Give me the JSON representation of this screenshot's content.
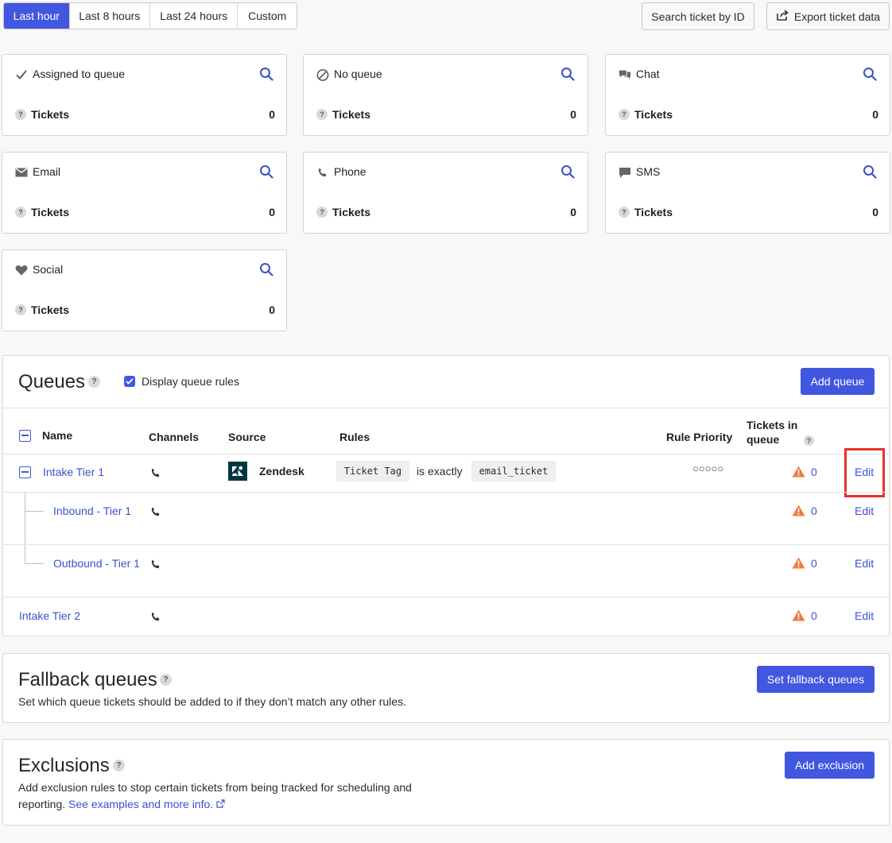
{
  "time_range": {
    "tabs": [
      "Last hour",
      "Last 8 hours",
      "Last 24 hours",
      "Custom"
    ],
    "active": "Last hour"
  },
  "toolbar": {
    "search_ticket_label": "Search ticket by ID",
    "export_label": "Export ticket data"
  },
  "cards": [
    {
      "title": "Assigned to queue",
      "icon": "check-icon",
      "label": "Tickets",
      "value": "0"
    },
    {
      "title": "No queue",
      "icon": "no-entry-icon",
      "label": "Tickets",
      "value": "0"
    },
    {
      "title": "Chat",
      "icon": "chat-icon",
      "label": "Tickets",
      "value": "0"
    },
    {
      "title": "Email",
      "icon": "envelope-icon",
      "label": "Tickets",
      "value": "0"
    },
    {
      "title": "Phone",
      "icon": "phone-icon",
      "label": "Tickets",
      "value": "0"
    },
    {
      "title": "SMS",
      "icon": "sms-icon",
      "label": "Tickets",
      "value": "0"
    },
    {
      "title": "Social",
      "icon": "heart-icon",
      "label": "Tickets",
      "value": "0"
    }
  ],
  "help_glyph": "?",
  "queues": {
    "title": "Queues",
    "display_rules_label": "Display queue rules",
    "add_button": "Add queue",
    "columns": {
      "name": "Name",
      "channels": "Channels",
      "source": "Source",
      "rules": "Rules",
      "rule_priority": "Rule Priority",
      "tickets_in_queue": "Tickets in queue"
    },
    "rows": [
      {
        "name": "Intake Tier 1",
        "source": "Zendesk",
        "rule_field": "Ticket Tag",
        "rule_op": "is exactly",
        "rule_value": "email_ticket",
        "priority": "○○○○○",
        "count": "0",
        "edit": "Edit"
      },
      {
        "name": "Inbound - Tier 1",
        "count": "0",
        "edit": "Edit"
      },
      {
        "name": "Outbound - Tier 1",
        "count": "0",
        "edit": "Edit"
      },
      {
        "name": "Intake Tier 2",
        "count": "0",
        "edit": "Edit"
      }
    ]
  },
  "fallback": {
    "title": "Fallback queues",
    "description": "Set which queue tickets should be added to if they don’t match any other rules.",
    "button": "Set fallback queues"
  },
  "exclusions": {
    "title": "Exclusions",
    "description": "Add exclusion rules to stop certain tickets from being tracked for scheduling and reporting.",
    "link": "See examples and more info.",
    "button": "Add exclusion"
  },
  "colors": {
    "accent": "#4257e0",
    "link": "#3b4fd0",
    "warning": "#f07b3f",
    "highlight": "#e8312a"
  }
}
